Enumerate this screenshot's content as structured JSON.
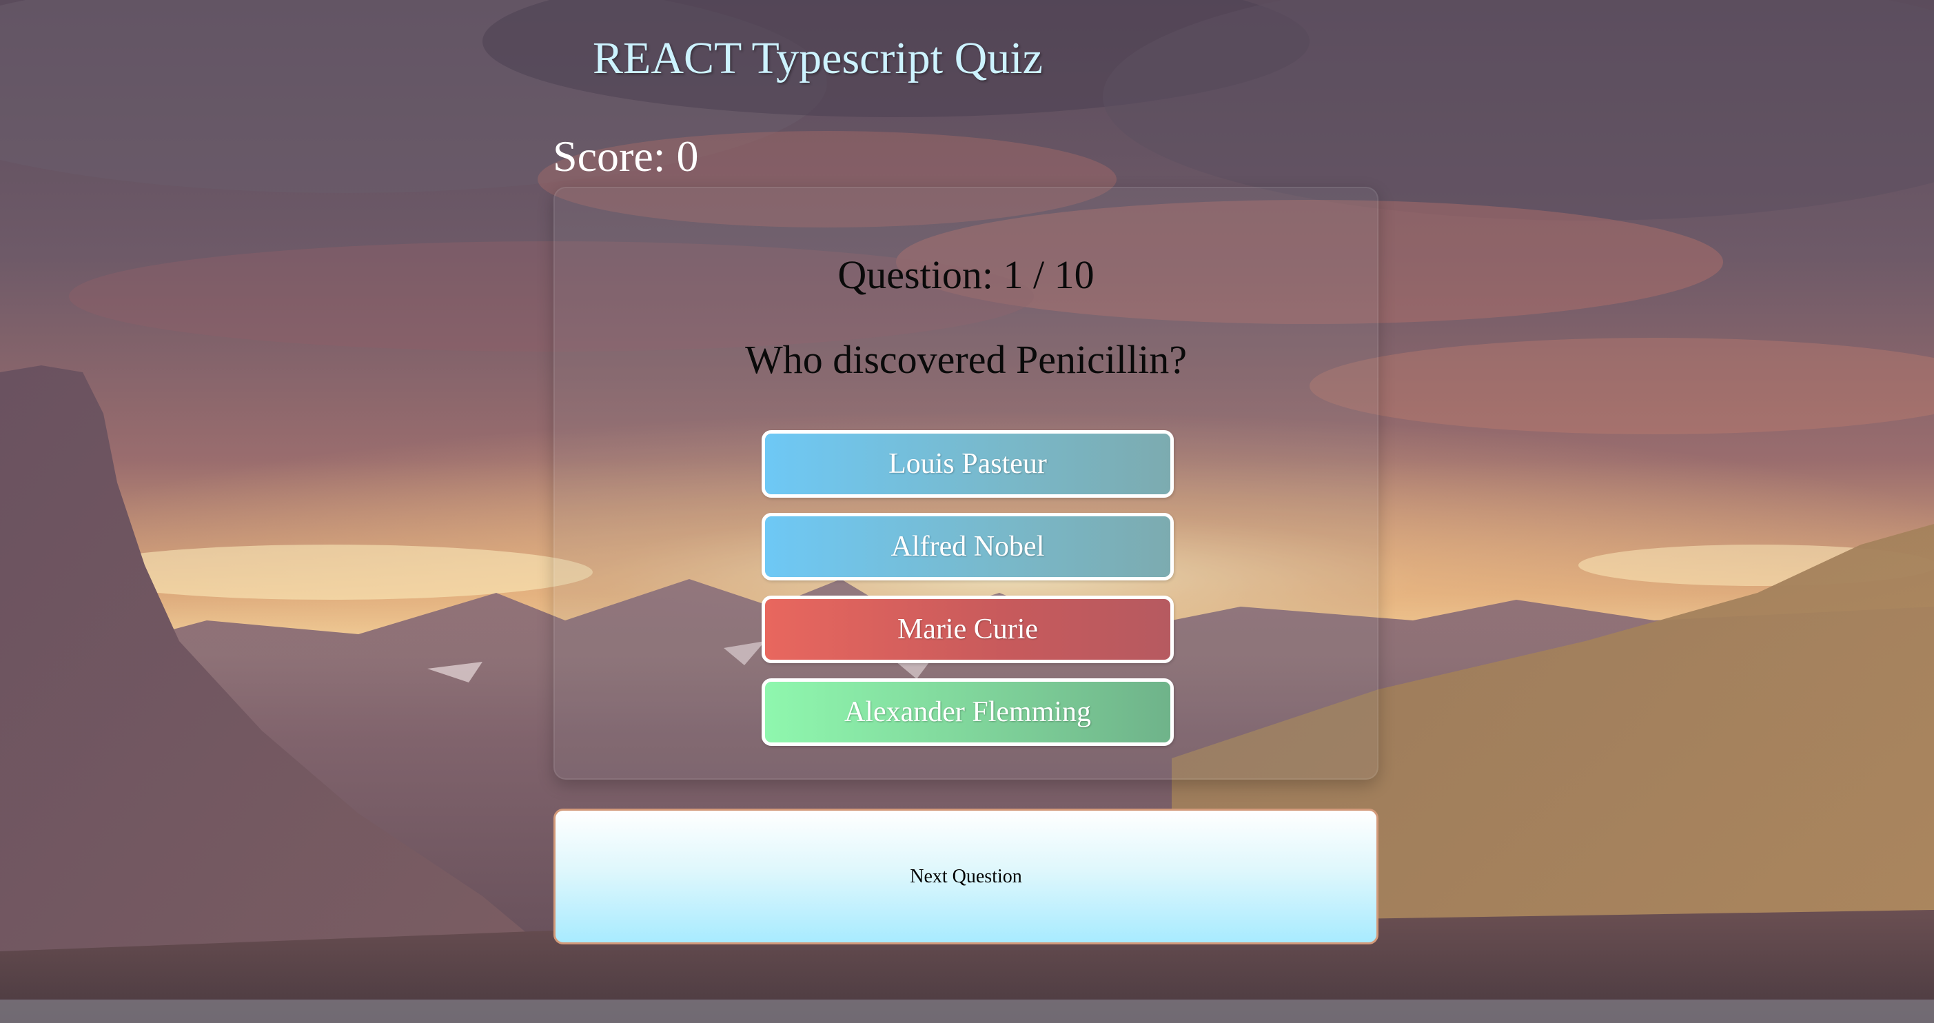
{
  "app": {
    "title": "REACT Typescript Quiz"
  },
  "score": {
    "label": "Score: 0",
    "value": 0
  },
  "question": {
    "number_label": "Question: 1 / 10",
    "current": 1,
    "total": 10,
    "text": "Who discovered Penicillin?"
  },
  "answers": [
    {
      "label": "Louis Pasteur",
      "state": "neutral"
    },
    {
      "label": "Alfred Nobel",
      "state": "neutral"
    },
    {
      "label": "Marie Curie",
      "state": "wrong"
    },
    {
      "label": "Alexander Flemming",
      "state": "correct"
    }
  ],
  "next_button": {
    "label": "Next Question"
  },
  "colors": {
    "neutral": "#6ec8f5",
    "wrong": "#e8675e",
    "correct": "#8ff7ae",
    "title": "#cdf3ff"
  },
  "background": {
    "icon": "mountain-sunset-landscape"
  }
}
